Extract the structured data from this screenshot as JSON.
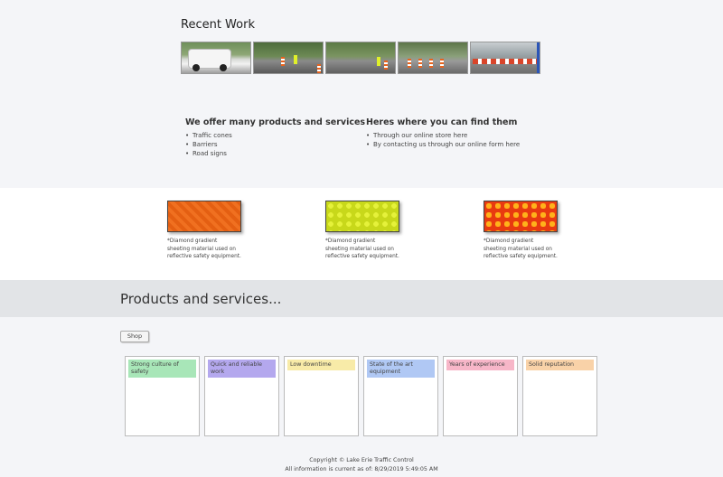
{
  "recent_work": {
    "title": "Recent Work",
    "thumbnails": [
      "truck-photo",
      "roadwork-cones-photo",
      "traffic-control-photo",
      "barrier-row-photo",
      "highway-barriers-photo"
    ]
  },
  "offer": {
    "heading": "We offer many products and services",
    "items": [
      "Traffic cones",
      "Barriers",
      "Road signs"
    ]
  },
  "find": {
    "heading": "Heres where you can find them",
    "items": [
      "Through our online store here",
      "By contacting us through our online form here"
    ]
  },
  "swatches": [
    {
      "color": "#f06a1a",
      "caption": "*Diamond gradient sheeting material used on reflective safety equipment."
    },
    {
      "color": "#d8e62a",
      "caption": "*Diamond gradient sheeting material used on reflective safety equipment."
    },
    {
      "color": "#f07b15",
      "caption": "*Diamond gradient sheeting material used on reflective safety equipment."
    }
  ],
  "products": {
    "title": "Products and services...",
    "shop_label": "Shop",
    "cards": [
      {
        "label": "Strong culture of safety",
        "color": "#a8e6b8"
      },
      {
        "label": "Quick and reliable work",
        "color": "#b4a8ee"
      },
      {
        "label": "Low downtime",
        "color": "#f8eba8"
      },
      {
        "label": "State of the art equipment",
        "color": "#b0c8f4"
      },
      {
        "label": "Years of experience",
        "color": "#f7b6c8"
      },
      {
        "label": "Solid reputation",
        "color": "#f9d2a8"
      }
    ]
  },
  "footer": {
    "copyright": "Copyright © Lake Erie Traffic Control",
    "current": "All information is current as of: 8/29/2019 5:49:05 AM"
  }
}
